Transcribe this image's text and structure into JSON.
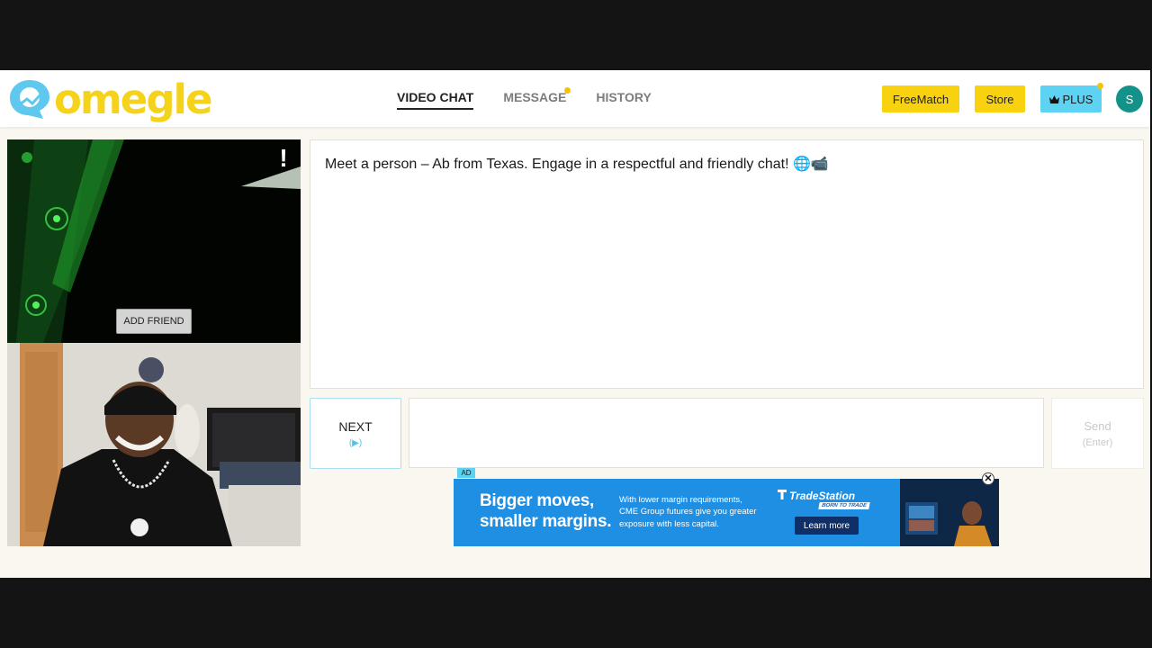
{
  "header": {
    "logo_text": "omegle",
    "nav": {
      "video_chat": "VIDEO CHAT",
      "message": "MESSAGE",
      "history": "HISTORY"
    },
    "buttons": {
      "freematch": "FreeMatch",
      "store": "Store",
      "plus": "PLUS"
    },
    "avatar_initial": "S"
  },
  "video": {
    "report_glyph": "!",
    "add_friend": "ADD FRIEND"
  },
  "chat": {
    "message": "Meet a person – Ab from Texas. Engage in a respectful and friendly chat! 🌐📹"
  },
  "controls": {
    "next_label": "NEXT",
    "next_hint": "(▶)",
    "input_value": "",
    "send_label": "Send",
    "send_hint": "(Enter)"
  },
  "ad": {
    "tag": "AD",
    "headline_1": "Bigger moves,",
    "headline_2": "smaller margins.",
    "body_1": "With lower margin requirements,",
    "body_2": "CME Group futures give you greater",
    "body_3": "exposure with less capital.",
    "brand": "TradeStation",
    "brand_tagline": "BORN TO TRADE",
    "cta": "Learn more",
    "close_glyph": "✕"
  },
  "colors": {
    "brand_yellow": "#f8d20f",
    "plus_cyan": "#5ed2f2",
    "avatar_teal": "#13928a",
    "ad_blue": "#1f8fe3"
  },
  "icons": {
    "logo": "omegle-logo-icon",
    "plus": "crown-icon",
    "report": "report-icon",
    "close": "close-icon"
  }
}
